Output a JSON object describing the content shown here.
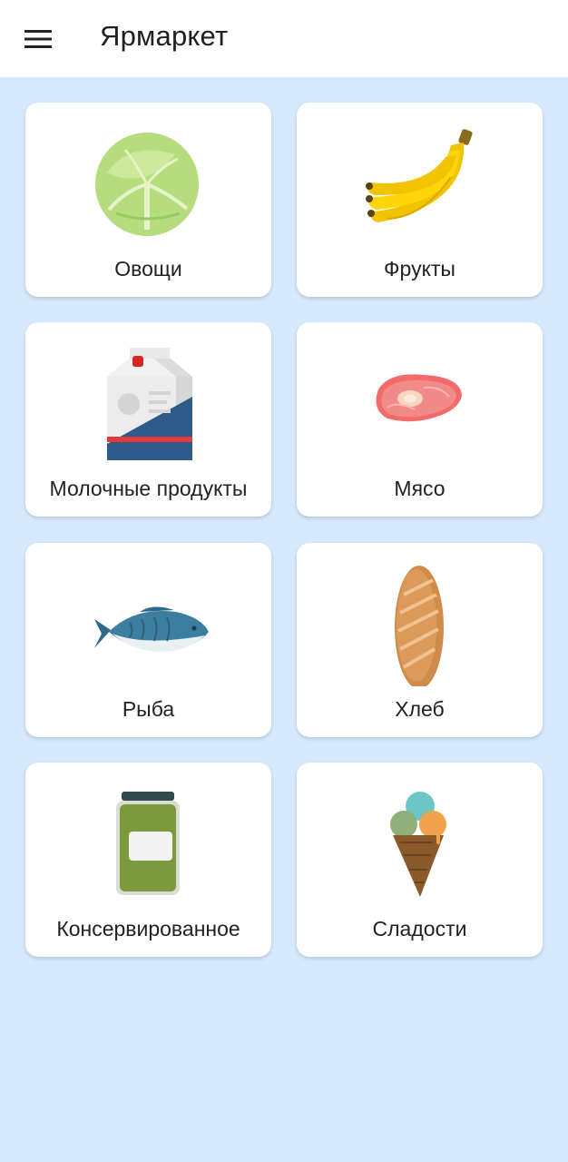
{
  "app_bar": {
    "title": "Ярмаркет",
    "menu_icon": "menu-icon"
  },
  "categories": [
    {
      "label": "Овощи",
      "icon": "cabbage-icon"
    },
    {
      "label": "Фрукты",
      "icon": "banana-icon"
    },
    {
      "label": "Молочные продукты",
      "icon": "milk-carton-icon"
    },
    {
      "label": "Мясо",
      "icon": "steak-icon"
    },
    {
      "label": "Рыба",
      "icon": "fish-icon"
    },
    {
      "label": "Хлеб",
      "icon": "bread-icon"
    },
    {
      "label": "Консервированное",
      "icon": "jar-icon"
    },
    {
      "label": "Сладости",
      "icon": "ice-cream-icon"
    }
  ],
  "colors": {
    "background": "#d6eaff",
    "app_bar": "#ffffff",
    "card": "#ffffff",
    "text": "#222222"
  }
}
